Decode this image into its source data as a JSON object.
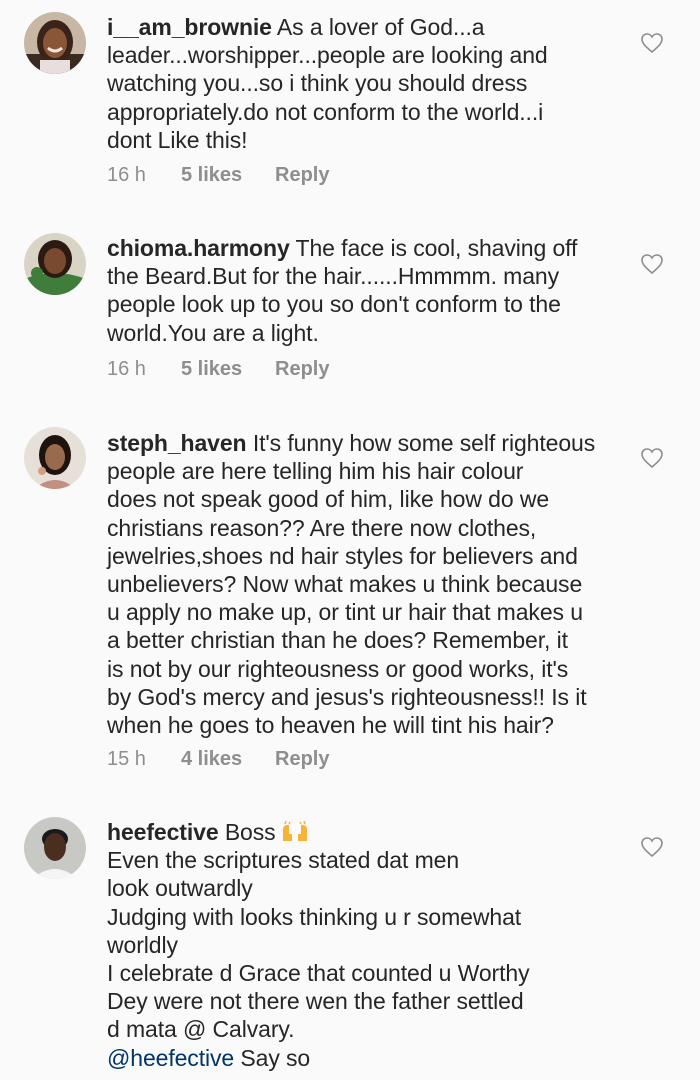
{
  "comments": [
    {
      "username": "i__am_brownie",
      "lines": [
        "As a lover of God...a",
        "leader...worshipper...people are looking and",
        "watching you...so i think you should dress",
        "appropriately.do not conform to the world...i",
        "dont Like this!"
      ],
      "time": "16 h",
      "likes": "5 likes",
      "reply": "Reply",
      "avatar_icon": "profile-photo-woman-smiling"
    },
    {
      "username": "chioma.harmony",
      "lines": [
        "The face is cool, shaving off",
        "the Beard.But for the hair......Hmmmm. many",
        "people look up to you so don't conform to the",
        "world.You are a light."
      ],
      "time": "16 h",
      "likes": "5 likes",
      "reply": "Reply",
      "avatar_icon": "profile-photo-woman-green"
    },
    {
      "username": "steph_haven",
      "lines": [
        "It's funny how some self righteous",
        "people are here telling him his hair colour",
        "does not speak good of him, like how do we",
        "christians reason?? Are there now clothes,",
        "jewelries,shoes nd hair styles for believers and",
        "unbelievers? Now what makes u think because",
        "u apply no make up, or tint ur hair that makes u",
        "a better christian than he does? Remember, it",
        "is not by our righteousness or good works, it's",
        "by God's mercy and jesus's righteousness!! Is it",
        "when he goes to heaven he will tint his hair?"
      ],
      "time": "15 h",
      "likes": "4 likes",
      "reply": "Reply",
      "avatar_icon": "profile-photo-woman-portrait"
    },
    {
      "username": "heefective",
      "lines": [
        "Boss",
        "Even the scriptures stated dat men",
        "look outwardly",
        "Judging with looks thinking u r somewhat",
        "worldly",
        "I celebrate d Grace that counted u Worthy",
        "Dey were not there wen the father settled",
        "d mata @ Calvary."
      ],
      "mention": "@heefective",
      "mention_text": "Say so",
      "emoji_icon": "raising-hands-emoji",
      "avatar_icon": "profile-photo-man"
    }
  ],
  "colors": {
    "background": "#fafafa",
    "text": "#262626",
    "meta": "#8e8e8e",
    "mention": "#003569",
    "heart_stroke": "#8e8e8e"
  },
  "icons": {
    "like": "heart-outline-icon"
  }
}
